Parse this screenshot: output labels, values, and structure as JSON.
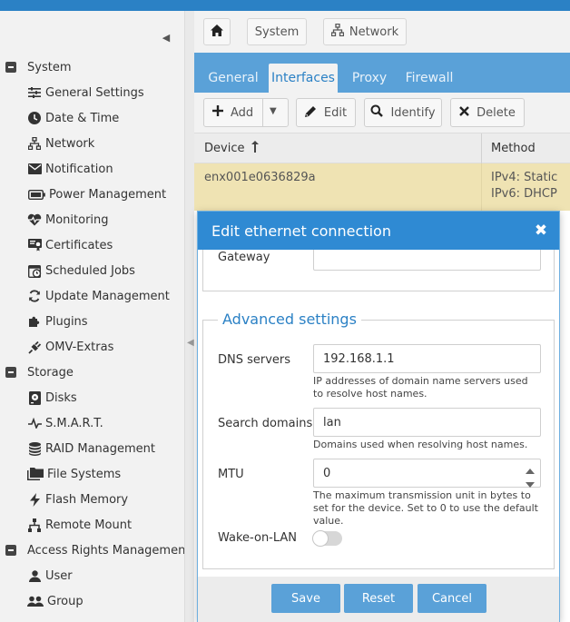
{
  "sidebar": {
    "items": [
      {
        "label": "System",
        "icon": "minus-box-icon",
        "kind": "group"
      },
      {
        "label": "General Settings",
        "icon": "sliders-icon",
        "kind": "sub"
      },
      {
        "label": "Date & Time",
        "icon": "clock-icon",
        "kind": "sub"
      },
      {
        "label": "Network",
        "icon": "network-icon",
        "kind": "sub"
      },
      {
        "label": "Notification",
        "icon": "envelope-icon",
        "kind": "sub"
      },
      {
        "label": "Power Management",
        "icon": "battery-icon",
        "kind": "sub"
      },
      {
        "label": "Monitoring",
        "icon": "heartbeat-icon",
        "kind": "sub"
      },
      {
        "label": "Certificates",
        "icon": "certificate-icon",
        "kind": "sub"
      },
      {
        "label": "Scheduled Jobs",
        "icon": "calendar-clock-icon",
        "kind": "sub"
      },
      {
        "label": "Update Management",
        "icon": "refresh-icon",
        "kind": "sub"
      },
      {
        "label": "Plugins",
        "icon": "puzzle-icon",
        "kind": "sub"
      },
      {
        "label": "OMV-Extras",
        "icon": "plug-icon",
        "kind": "sub"
      },
      {
        "label": "Storage",
        "icon": "minus-box-icon",
        "kind": "group"
      },
      {
        "label": "Disks",
        "icon": "disk-icon",
        "kind": "sub"
      },
      {
        "label": "S.M.A.R.T.",
        "icon": "pulse-icon",
        "kind": "sub"
      },
      {
        "label": "RAID Management",
        "icon": "database-icon",
        "kind": "sub"
      },
      {
        "label": "File Systems",
        "icon": "folders-icon",
        "kind": "sub"
      },
      {
        "label": "Flash Memory",
        "icon": "bolt-icon",
        "kind": "sub"
      },
      {
        "label": "Remote Mount",
        "icon": "sitemap-icon",
        "kind": "sub"
      },
      {
        "label": "Access Rights Management",
        "icon": "minus-box-icon",
        "kind": "group"
      },
      {
        "label": "User",
        "icon": "user-icon",
        "kind": "sub"
      },
      {
        "label": "Group",
        "icon": "users-icon",
        "kind": "sub"
      }
    ]
  },
  "breadcrumb": {
    "home_icon": "home-icon",
    "items": [
      "System",
      "Network"
    ]
  },
  "tabs": [
    {
      "label": "General",
      "active": false
    },
    {
      "label": "Interfaces",
      "active": true
    },
    {
      "label": "Proxy",
      "active": false
    },
    {
      "label": "Firewall",
      "active": false
    }
  ],
  "toolbar": {
    "add": "Add",
    "edit": "Edit",
    "identify": "Identify",
    "delete": "Delete"
  },
  "grid": {
    "columns": [
      "Device",
      "Method"
    ],
    "rows": [
      {
        "device": "enx001e0636829a",
        "method_ipv4": "IPv4: Static",
        "method_ipv6": "IPv6: DHCP"
      }
    ]
  },
  "dialog": {
    "title": "Edit ethernet connection",
    "gateway_label": "Gateway",
    "gateway_value": "",
    "advanced_legend": "Advanced settings",
    "dns_label": "DNS servers",
    "dns_value": "192.168.1.1",
    "dns_hint": "IP addresses of domain name servers used to resolve host names.",
    "search_label": "Search domains",
    "search_value": "lan",
    "search_hint": "Domains used when resolving host names.",
    "mtu_label": "MTU",
    "mtu_value": "0",
    "mtu_hint": "The maximum transmission unit in bytes to set for the device. Set to 0 to use the default value.",
    "wol_label": "Wake-on-LAN",
    "wol_enabled": false,
    "save": "Save",
    "reset": "Reset",
    "cancel": "Cancel"
  },
  "colors": {
    "accent": "#2f8ad3",
    "tabbar": "#5aa1d8",
    "selected_row": "#efe3b3"
  }
}
